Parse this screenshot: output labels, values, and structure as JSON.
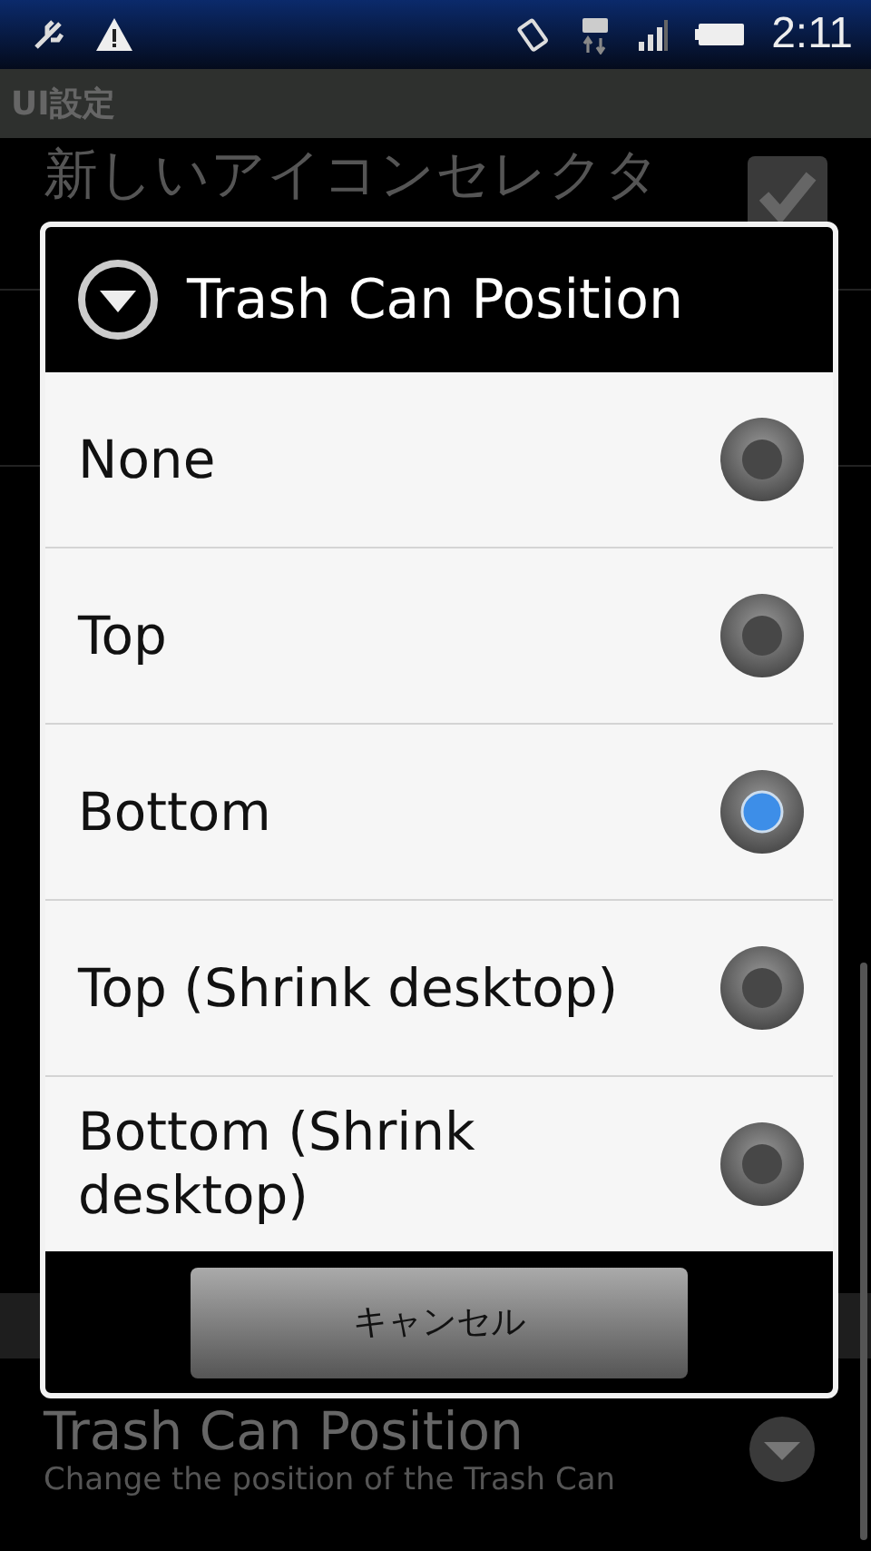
{
  "status_bar": {
    "time": "2:11"
  },
  "background": {
    "header": "UI設定",
    "items": [
      {
        "title": "新しいアイコンセレクタ",
        "checked": true
      }
    ],
    "setting": {
      "title": "Trash Can Position",
      "summary": "Change the position of the Trash Can"
    }
  },
  "dialog": {
    "title": "Trash Can Position",
    "options": [
      {
        "label": "None",
        "selected": false
      },
      {
        "label": "Top",
        "selected": false
      },
      {
        "label": "Bottom",
        "selected": true
      },
      {
        "label": "Top (Shrink desktop)",
        "selected": false
      },
      {
        "label": "Bottom (Shrink desktop)",
        "selected": false
      }
    ],
    "cancel": "キャンセル"
  }
}
